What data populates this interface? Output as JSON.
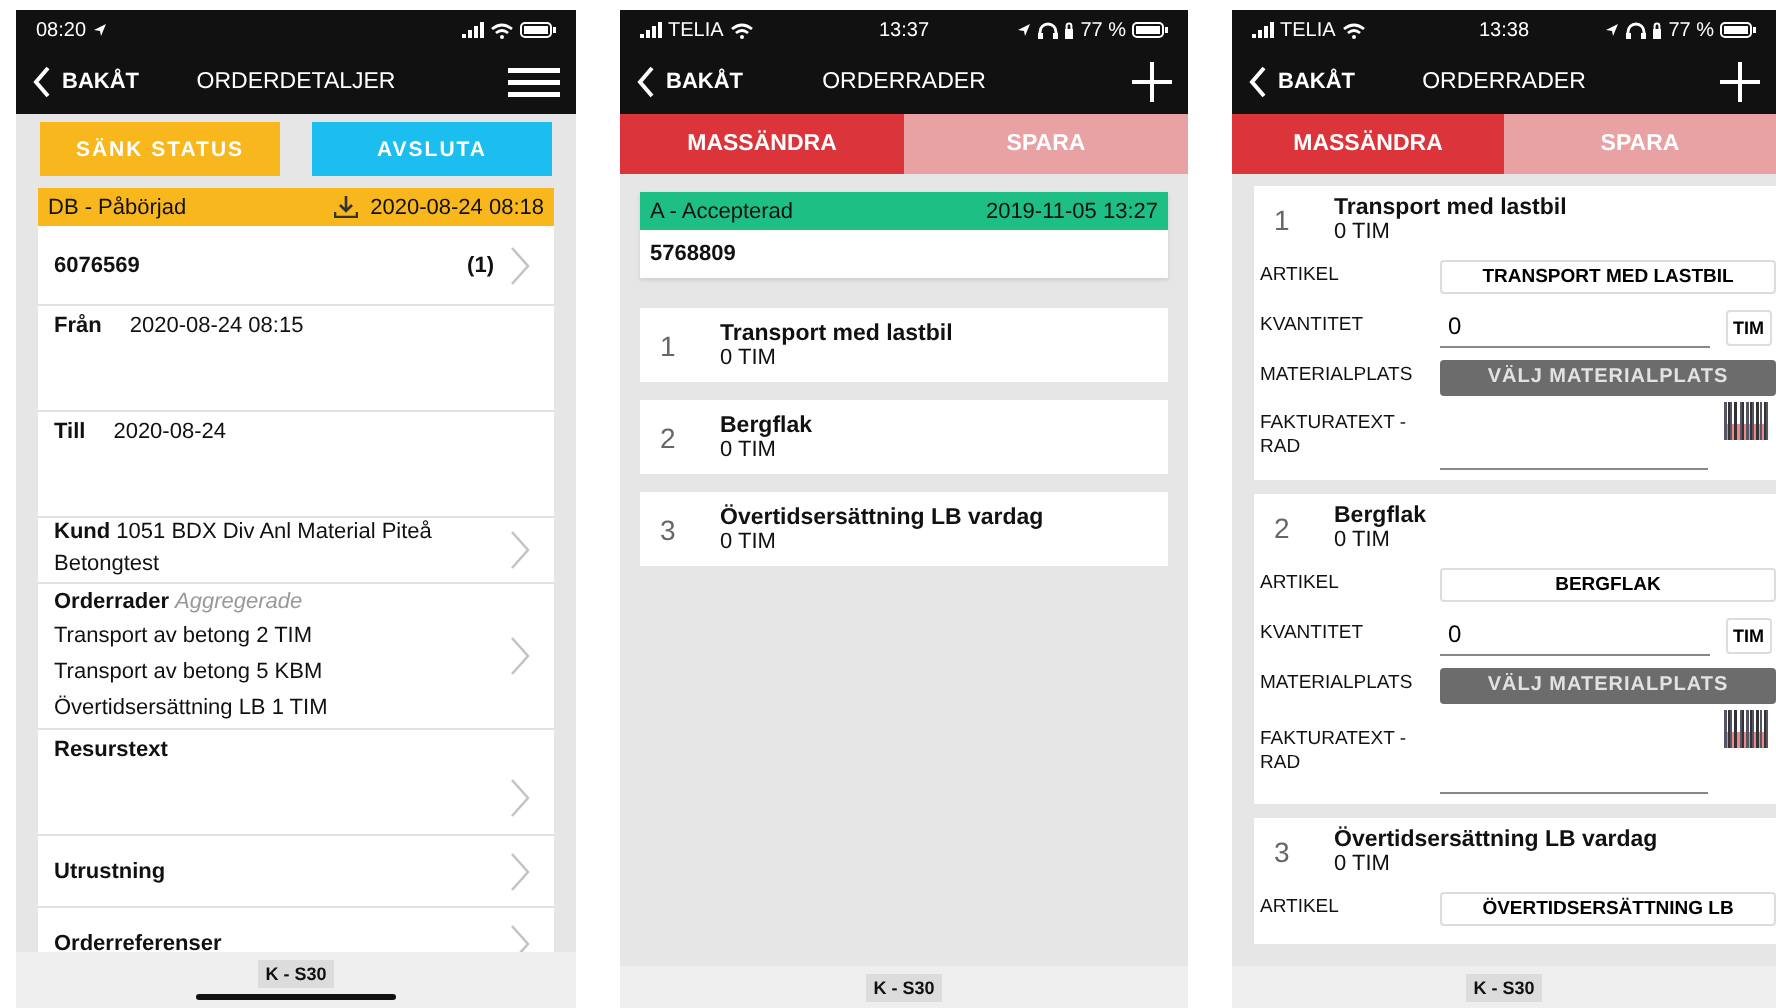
{
  "screens": [
    {
      "kind": "details",
      "status_bar": {
        "time": "08:20"
      },
      "nav": {
        "back": "BAKÅT",
        "title": "ORDERDETALJER"
      },
      "buttons": [
        {
          "label": "SÄNK STATUS",
          "color": "#f8b71c"
        },
        {
          "label": "AVSLUTA",
          "color": "#1cbef0"
        }
      ],
      "status": {
        "label": "DB - Påbörjad",
        "date": "2020-08-24 08:18",
        "color": "#f8b71c"
      },
      "sections": [
        {
          "kind": "order",
          "number": "6076569",
          "count": "(1)"
        },
        {
          "kind": "field",
          "label": "Från",
          "value": "2020-08-24 08:15"
        },
        {
          "kind": "field",
          "label": "Till",
          "value": "2020-08-24"
        },
        {
          "kind": "paragraph",
          "text": "**Kund** 1051 BDX Div Anl Material Piteå Betongtest"
        },
        {
          "kind": "lines",
          "title": "Orderrader",
          "note": "Aggregerade",
          "lines": [
            "Transport av betong 2 TIM",
            "Transport av betong 5 KBM",
            "Övertidsersättning LB 1 TIM"
          ]
        },
        {
          "kind": "block",
          "title": "Resurstext"
        },
        {
          "kind": "link",
          "title": "Utrustning"
        },
        {
          "kind": "link",
          "title": "Orderreferenser"
        }
      ],
      "footer": "K - S30"
    },
    {
      "kind": "rows",
      "status_bar": {
        "carrier": "TELIA",
        "time": "13:37",
        "battery": "77 %"
      },
      "nav": {
        "back": "BAKÅT",
        "title": "ORDERRADER"
      },
      "tabs": [
        {
          "label": "MASSÄNDRA",
          "selected": true
        },
        {
          "label": "SPARA",
          "selected": false
        }
      ],
      "status": {
        "label": "A - Accepterad",
        "date": "2019-11-05 13:27",
        "color": "#1dbf84"
      },
      "order_number": "5768809",
      "rows": [
        {
          "number": "1",
          "title": "Transport med lastbil",
          "quantity": "0 TIM"
        },
        {
          "number": "2",
          "title": "Bergflak",
          "quantity": "0 TIM"
        },
        {
          "number": "3",
          "title": "Övertidsersättning LB vardag",
          "quantity": "0 TIM"
        }
      ],
      "footer": "K - S30"
    },
    {
      "kind": "edit",
      "status_bar": {
        "carrier": "TELIA",
        "time": "13:38",
        "battery": "77 %"
      },
      "nav": {
        "back": "BAKÅT",
        "title": "ORDERRADER"
      },
      "tabs": [
        {
          "label": "MASSÄNDRA",
          "selected": true
        },
        {
          "label": "SPARA",
          "selected": false
        }
      ],
      "rows": [
        {
          "number": "1",
          "title": "Transport med lastbil",
          "quantity": "0 TIM",
          "fields": [
            {
              "kind": "select",
              "label": "ARTIKEL",
              "value": "TRANSPORT MED LASTBIL"
            },
            {
              "kind": "quantity",
              "label": "KVANTITET",
              "value": "0",
              "unit": "TIM"
            },
            {
              "kind": "picker",
              "label": "MATERIALPLATS",
              "value": "VÄLJ MATERIALPLATS"
            },
            {
              "kind": "text",
              "label": "FAKTURATEXT - RAD"
            }
          ]
        },
        {
          "number": "2",
          "title": "Bergflak",
          "quantity": "0 TIM",
          "fields": [
            {
              "kind": "select",
              "label": "ARTIKEL",
              "value": "BERGFLAK"
            },
            {
              "kind": "quantity",
              "label": "KVANTITET",
              "value": "0",
              "unit": "TIM"
            },
            {
              "kind": "picker",
              "label": "MATERIALPLATS",
              "value": "VÄLJ MATERIALPLATS"
            },
            {
              "kind": "text",
              "label": "FAKTURATEXT - RAD"
            }
          ]
        },
        {
          "number": "3",
          "title": "Övertidsersättning LB vardag",
          "quantity": "0 TIM",
          "fields": [
            {
              "kind": "select",
              "label": "ARTIKEL",
              "value": "ÖVERTIDSERSÄTTNING LB"
            }
          ]
        }
      ],
      "footer": "K - S30"
    }
  ]
}
